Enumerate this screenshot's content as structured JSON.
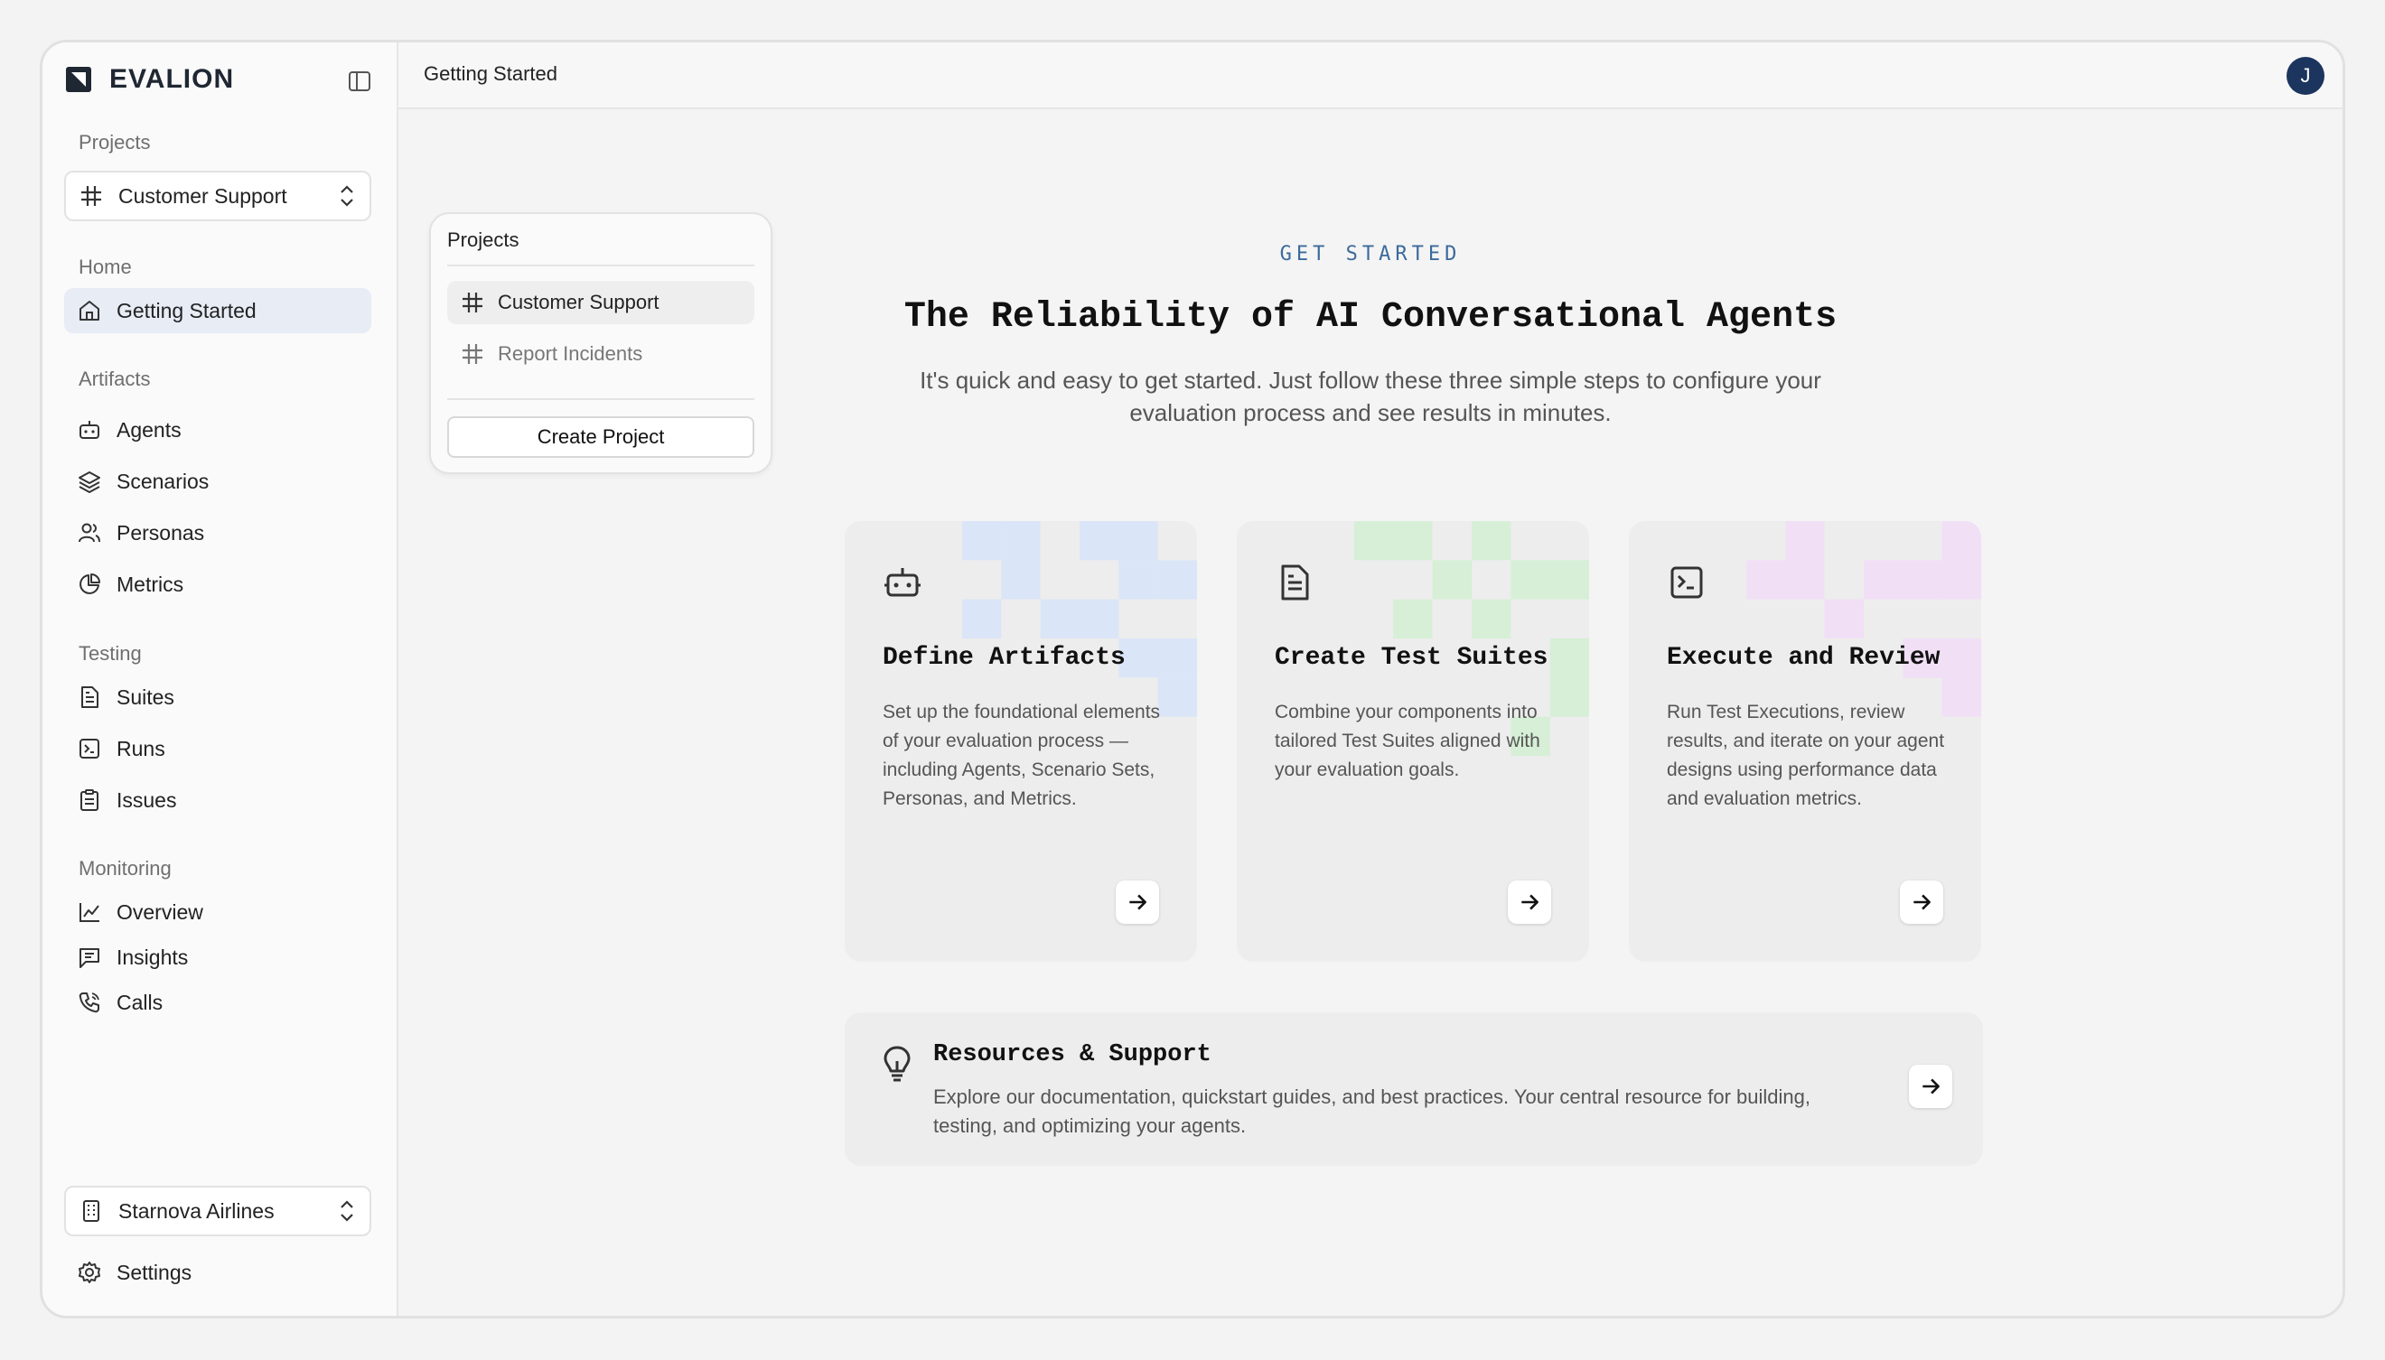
{
  "app": {
    "brand": "EVALION"
  },
  "header": {
    "title": "Getting Started",
    "avatar_initial": "J"
  },
  "sidebar": {
    "projects_label": "Projects",
    "project_selector": "Customer Support",
    "home_label": "Home",
    "home_items": [
      {
        "label": "Getting Started",
        "icon": "home-icon"
      }
    ],
    "artifacts_label": "Artifacts",
    "artifacts_items": [
      {
        "label": "Agents",
        "icon": "bot-icon"
      },
      {
        "label": "Scenarios",
        "icon": "layers-icon"
      },
      {
        "label": "Personas",
        "icon": "users-icon"
      },
      {
        "label": "Metrics",
        "icon": "pie-chart-icon"
      }
    ],
    "testing_label": "Testing",
    "testing_items": [
      {
        "label": "Suites",
        "icon": "file-text-icon"
      },
      {
        "label": "Runs",
        "icon": "terminal-icon"
      },
      {
        "label": "Issues",
        "icon": "clipboard-icon"
      }
    ],
    "monitoring_label": "Monitoring",
    "monitoring_items": [
      {
        "label": "Overview",
        "icon": "line-chart-icon"
      },
      {
        "label": "Insights",
        "icon": "message-square-icon"
      },
      {
        "label": "Calls",
        "icon": "phone-icon"
      }
    ],
    "org_selector": "Starnova Airlines",
    "settings_label": "Settings"
  },
  "projects_popover": {
    "title": "Projects",
    "items": [
      {
        "label": "Customer Support",
        "active": true
      },
      {
        "label": "Report Incidents",
        "active": false
      }
    ],
    "create_label": "Create Project"
  },
  "main": {
    "kicker": "GET STARTED",
    "title": "The Reliability of AI Conversational Agents",
    "subtitle": "It's quick and easy to get started. Just follow these three simple steps to configure your evaluation process and see results in minutes.",
    "cards": [
      {
        "title": "Define Artifacts",
        "description": "Set up the foundational elements of your evaluation process — including Agents, Scenario Sets, Personas, and Metrics.",
        "icon": "bot-icon",
        "accent": "#dbe5f8"
      },
      {
        "title": "Create Test Suites",
        "description": "Combine your components into tailored Test Suites aligned with your evaluation goals.",
        "icon": "file-text-icon",
        "accent": "#d6efd6"
      },
      {
        "title": "Execute and Review",
        "description": "Run Test Executions, review results, and iterate on your agent designs using performance data and evaluation metrics.",
        "icon": "terminal-icon",
        "accent": "#f1dff6"
      }
    ],
    "resources": {
      "title": "Resources & Support",
      "description": "Explore our documentation, quickstart guides, and best practices. Your central resource for building, testing, and optimizing your agents.",
      "icon": "lightbulb-icon"
    }
  },
  "colors": {
    "accent_active": "#e7ecf5",
    "avatar": "#1c355e",
    "kicker": "#3b6a9c"
  }
}
